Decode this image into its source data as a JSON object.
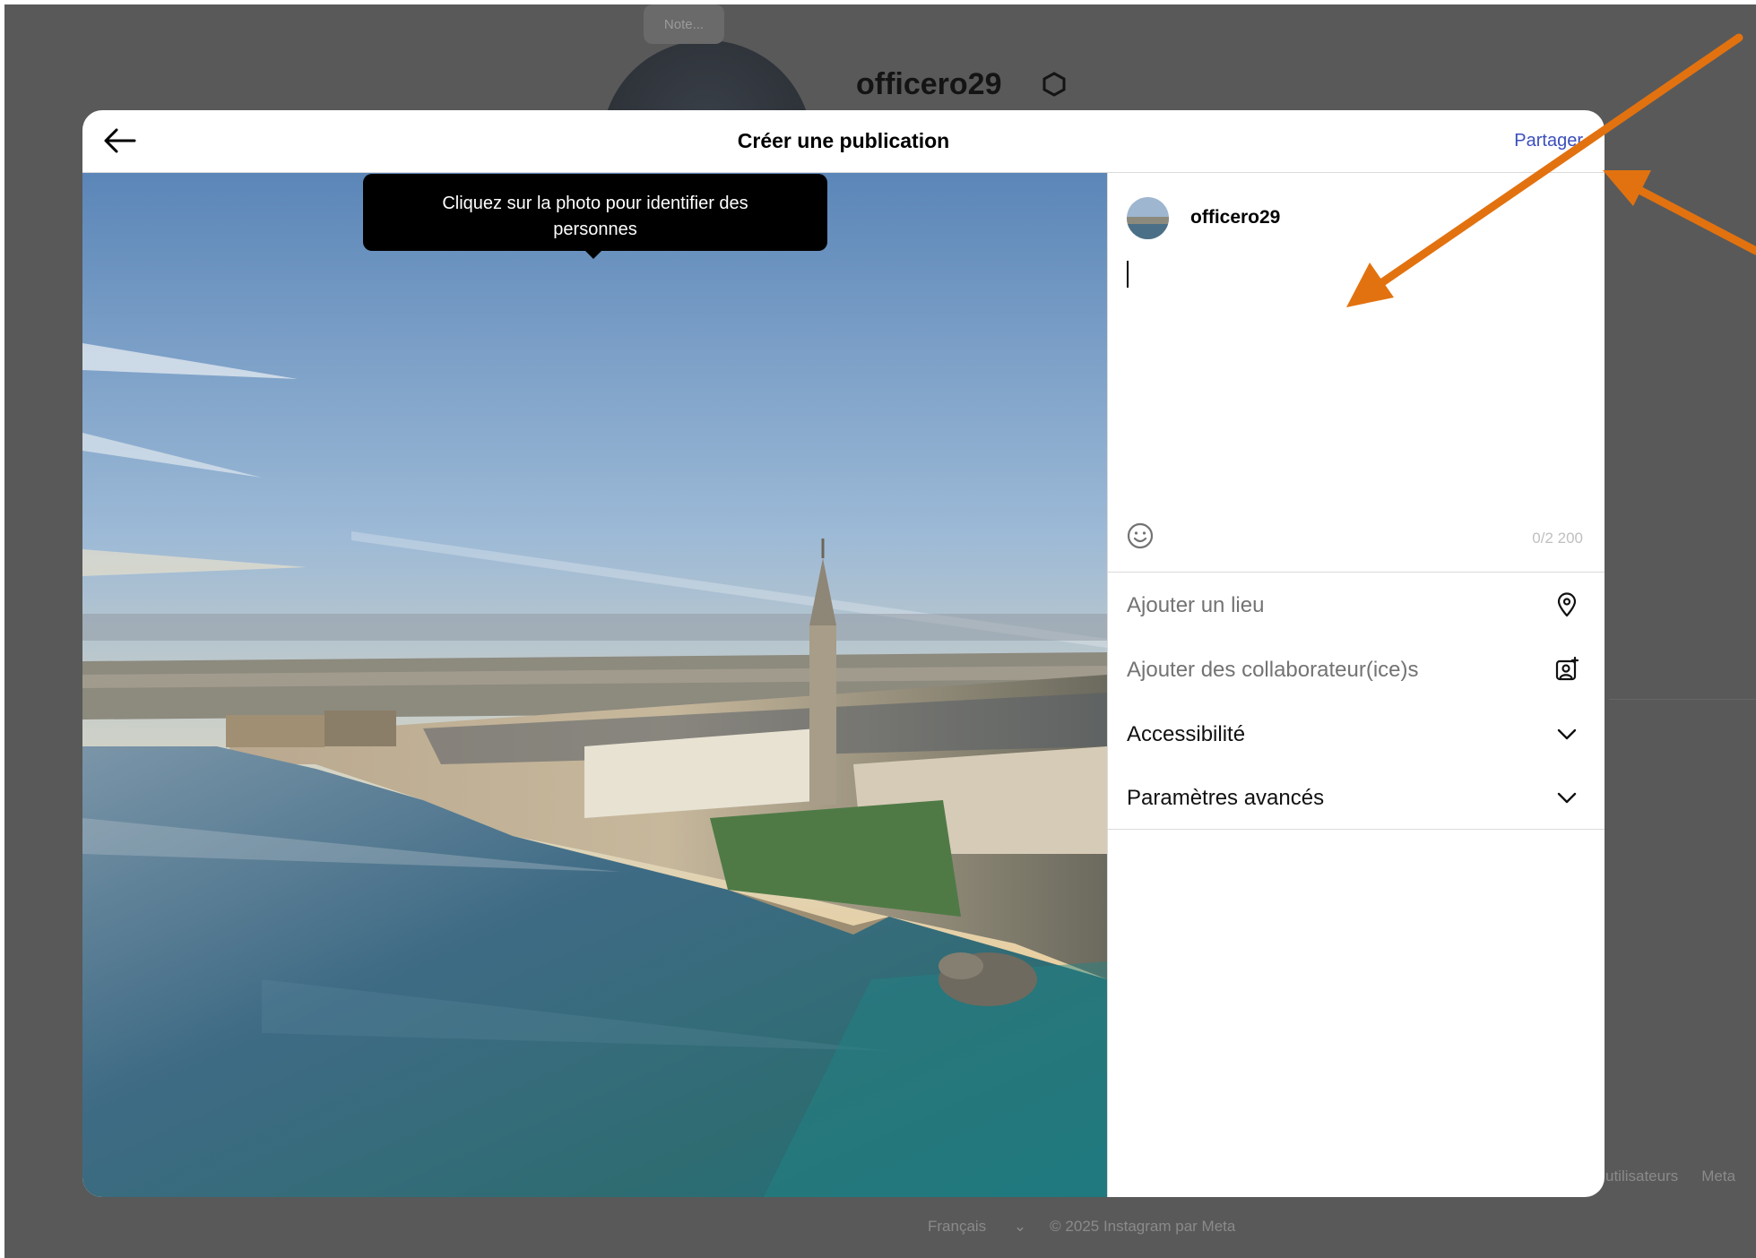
{
  "background": {
    "note_label": "Note...",
    "profile_username": "officero29",
    "footer_links": [
      "utilisateurs",
      "Meta"
    ],
    "language": "Français",
    "copyright": "© 2025 Instagram par Meta"
  },
  "modal": {
    "title": "Créer une publication",
    "share_label": "Partager",
    "tooltip": "Cliquez sur la photo pour identifier des personnes",
    "username": "officero29",
    "caption_value": "",
    "char_counter": "0/2 200",
    "options": [
      {
        "label": "Ajouter un lieu",
        "icon": "location-pin-icon"
      },
      {
        "label": "Ajouter des collaborateur(ice)s",
        "icon": "add-person-icon"
      },
      {
        "label": "Accessibilité",
        "icon": "chevron-down-icon"
      },
      {
        "label": "Paramètres avancés",
        "icon": "chevron-down-icon"
      }
    ]
  },
  "colors": {
    "backdrop": "#595959",
    "share_link": "#3c4fbb",
    "annotation_arrow": "#e2720f"
  }
}
